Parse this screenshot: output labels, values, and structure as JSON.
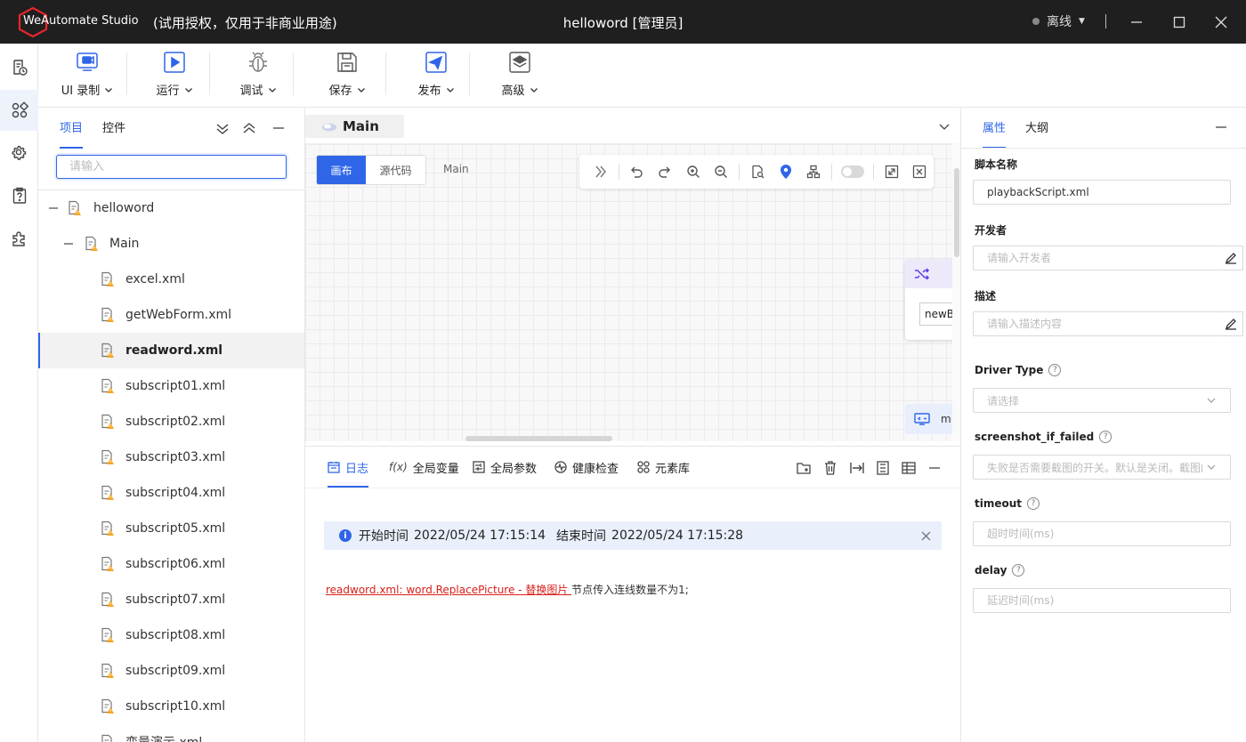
{
  "titlebar": {
    "brand": "WeAutomate Studio",
    "license": "(试用授权，仅用于非商业用途)",
    "title": "helloword [管理员]",
    "status": "离线"
  },
  "toolbar": {
    "items": [
      {
        "label": "UI 录制",
        "icon": "video-camera-icon"
      },
      {
        "label": "运行",
        "icon": "play-icon"
      },
      {
        "label": "调试",
        "icon": "bug-icon"
      },
      {
        "label": "保存",
        "icon": "save-disk-icon"
      },
      {
        "label": "发布",
        "icon": "send-plane-icon"
      },
      {
        "label": "高级",
        "icon": "layers-icon"
      }
    ]
  },
  "leftpanel": {
    "tabs": [
      "项目",
      "控件"
    ],
    "search_placeholder": "请输入",
    "tree": [
      {
        "label": "helloword",
        "level": 0,
        "toggle": "—"
      },
      {
        "label": "Main",
        "level": 1,
        "toggle": "—"
      },
      {
        "label": "excel.xml",
        "level": 2
      },
      {
        "label": "getWebForm.xml",
        "level": 2
      },
      {
        "label": "readword.xml",
        "level": 2,
        "selected": true
      },
      {
        "label": "subscript01.xml",
        "level": 2
      },
      {
        "label": "subscript02.xml",
        "level": 2
      },
      {
        "label": "subscript03.xml",
        "level": 2
      },
      {
        "label": "subscript04.xml",
        "level": 2
      },
      {
        "label": "subscript05.xml",
        "level": 2
      },
      {
        "label": "subscript06.xml",
        "level": 2
      },
      {
        "label": "subscript07.xml",
        "level": 2
      },
      {
        "label": "subscript08.xml",
        "level": 2
      },
      {
        "label": "subscript09.xml",
        "level": 2
      },
      {
        "label": "subscript10.xml",
        "level": 2
      },
      {
        "label": "变量演示.xml",
        "level": 2
      }
    ]
  },
  "editor": {
    "tab": "Main",
    "mode_canvas": "画布",
    "mode_source": "源代码",
    "crumb": "Main",
    "node_input": "newBl",
    "node2_text": "m"
  },
  "logpanel": {
    "tabs": [
      {
        "label": "日志",
        "icon": "calendar-icon"
      },
      {
        "label": "全局变量",
        "icon": "function-icon"
      },
      {
        "label": "全局参数",
        "icon": "params-icon"
      },
      {
        "label": "健康检查",
        "icon": "heartbeat-icon"
      },
      {
        "label": "元素库",
        "icon": "grid-icon"
      }
    ],
    "info": {
      "start_label": "开始时间",
      "start_time": "2022/05/24 17:15:14",
      "end_label": "结束时间",
      "end_time": "2022/05/24 17:15:28"
    },
    "log_link": "readword.xml: word.ReplacePicture - 替换图片 ",
    "log_text": "节点传入连线数量不为1;"
  },
  "rightpanel": {
    "tabs": [
      "属性",
      "大纲"
    ],
    "fields": {
      "script_name_label": "脚本名称",
      "script_name_value": "playbackScript.xml",
      "developer_label": "开发者",
      "developer_placeholder": "请输入开发者",
      "desc_label": "描述",
      "desc_placeholder": "请输入描述内容",
      "driver_label": "Driver Type",
      "driver_placeholder": "请选择",
      "screenshot_label": "screenshot_if_failed",
      "screenshot_placeholder": "失败是否需要截图的开关。默认是关闭。截图的",
      "timeout_label": "timeout",
      "timeout_placeholder": "超时时间(ms)",
      "delay_label": "delay",
      "delay_placeholder": "延迟时间(ms)"
    }
  },
  "colors": {
    "accent": "#2f66e8",
    "titlebar": "#1f1f1f",
    "error": "#d91e18"
  }
}
